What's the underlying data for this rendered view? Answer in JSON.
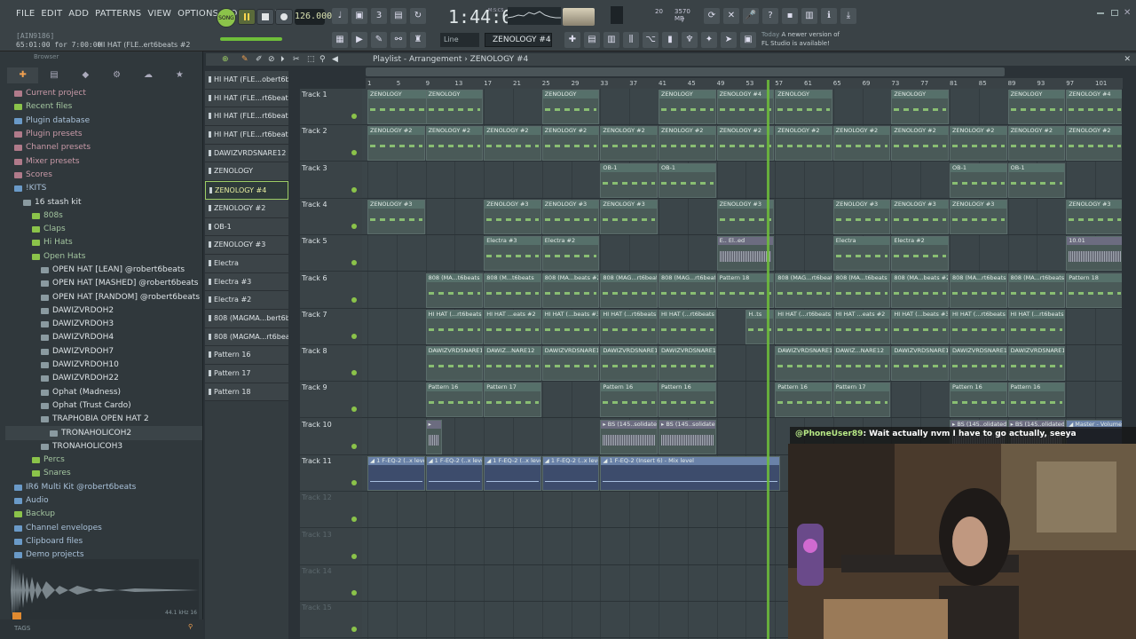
{
  "menus": [
    "FILE",
    "EDIT",
    "ADD",
    "PATTERNS",
    "VIEW",
    "OPTIONS",
    "TOOLS",
    "HELP"
  ],
  "hint": {
    "line1": "[AIN9186]",
    "time": "65:01:00 for 7:00:00",
    "channel": "HI HAT (FLE..ert6beats #2"
  },
  "transport": {
    "song_label": "SONG",
    "tempo": "126.000",
    "time": "1:44:63",
    "time_unit": "M:S:CS"
  },
  "cpu": {
    "memory": "3570 MB",
    "poly": "20",
    "voices": "7"
  },
  "toolbar": {
    "snap": "Line",
    "pattern": "ZENOLOGY #4"
  },
  "news": {
    "date": "Today",
    "text1": "A newer version of",
    "text2": "FL Studio is available!"
  },
  "browser": {
    "header": "Browser",
    "tabs": [
      "✚",
      "▤",
      "◆",
      "⚙",
      "☁",
      "★"
    ],
    "items": [
      {
        "label": "Current project",
        "color": "pink",
        "indent": 1
      },
      {
        "label": "Recent files",
        "color": "green",
        "indent": 1
      },
      {
        "label": "Plugin database",
        "color": "blue",
        "indent": 1
      },
      {
        "label": "Plugin presets",
        "color": "pink",
        "indent": 1
      },
      {
        "label": "Channel presets",
        "color": "pink",
        "indent": 1
      },
      {
        "label": "Mixer presets",
        "color": "pink",
        "indent": 1
      },
      {
        "label": "Scores",
        "color": "pink",
        "indent": 1
      },
      {
        "label": "!KITS",
        "color": "blue",
        "indent": 1
      },
      {
        "label": "16 stash kit",
        "color": "white",
        "indent": 2
      },
      {
        "label": "808s",
        "color": "green",
        "indent": 3
      },
      {
        "label": "Claps",
        "color": "green",
        "indent": 3
      },
      {
        "label": "Hi Hats",
        "color": "green",
        "indent": 3
      },
      {
        "label": "Open Hats",
        "color": "green",
        "indent": 3
      },
      {
        "label": "OPEN HAT [LEAN] @robert6beats",
        "color": "white",
        "indent": 4
      },
      {
        "label": "OPEN HAT [MASHED] @robert6beats",
        "color": "white",
        "indent": 4
      },
      {
        "label": "OPEN HAT [RANDOM] @robert6beats",
        "color": "white",
        "indent": 4
      },
      {
        "label": "DAWIZVRDOH2",
        "color": "white",
        "indent": 4
      },
      {
        "label": "DAWIZVRDOH3",
        "color": "white",
        "indent": 4
      },
      {
        "label": "DAWIZVRDOH4",
        "color": "white",
        "indent": 4
      },
      {
        "label": "DAWIZVRDOH7",
        "color": "white",
        "indent": 4
      },
      {
        "label": "DAWIZVRDOH10",
        "color": "white",
        "indent": 4
      },
      {
        "label": "DAWIZVRDOH22",
        "color": "white",
        "indent": 4
      },
      {
        "label": "Ophat (Madness)",
        "color": "white",
        "indent": 4
      },
      {
        "label": "Ophat (Trust Cardo)",
        "color": "white",
        "indent": 4
      },
      {
        "label": "TRAPHOBIA OPEN HAT 2",
        "color": "white",
        "indent": 4
      },
      {
        "label": "TRONAHOLICOH2",
        "color": "white",
        "indent": 5,
        "selected": true
      },
      {
        "label": "TRONAHOLICOH3",
        "color": "white",
        "indent": 4
      },
      {
        "label": "Percs",
        "color": "green",
        "indent": 3
      },
      {
        "label": "Snares",
        "color": "green",
        "indent": 3
      },
      {
        "label": "IR6 Multi Kit @robert6beats",
        "color": "blue",
        "indent": 1
      },
      {
        "label": "Audio",
        "color": "blue",
        "indent": 1
      },
      {
        "label": "Backup",
        "color": "green",
        "indent": 1
      },
      {
        "label": "Channel envelopes",
        "color": "blue",
        "indent": 1
      },
      {
        "label": "Clipboard files",
        "color": "blue",
        "indent": 1
      },
      {
        "label": "Demo projects",
        "color": "blue",
        "indent": 1
      }
    ],
    "tags": "TAGS",
    "sample_rate": "44.1 kHz 16"
  },
  "picker": [
    "HI HAT (FLE...obert6beats",
    "HI HAT (FLE...rt6beats #3",
    "HI HAT (FLE...rt6beats #2",
    "HI HAT (FLE...rt6beats #4",
    "DAWIZVRDSNARE12",
    "ZENOLOGY",
    "ZENOLOGY #4",
    "ZENOLOGY #2",
    "OB-1",
    "ZENOLOGY #3",
    "Electra",
    "Electra #3",
    "Electra #2",
    "808 (MAGMA...bert6beats",
    "808 (MAGMA...rt6beats #2",
    "Pattern 16",
    "Pattern 17",
    "Pattern 18"
  ],
  "picker_selected": 6,
  "playlist": {
    "title": "Playlist - Arrangement › ZENOLOGY #4",
    "ruler": [
      "1",
      "5",
      "9",
      "13",
      "17",
      "21",
      "25",
      "29",
      "33",
      "37",
      "41",
      "45",
      "49",
      "53",
      "57",
      "61",
      "65",
      "69",
      "73",
      "77",
      "81",
      "85",
      "89",
      "93",
      "97",
      "101"
    ],
    "tracks": [
      "Track 1",
      "Track 2",
      "Track 3",
      "Track 4",
      "Track 5",
      "Track 6",
      "Track 7",
      "Track 8",
      "Track 9",
      "Track 10",
      "Track 11",
      "Track 12",
      "Track 13",
      "Track 14",
      "Track 15"
    ],
    "clips": [
      {
        "t": 0,
        "s": 0,
        "e": 3,
        "l": "ZENOLOGY"
      },
      {
        "t": 0,
        "s": 2,
        "e": 4,
        "l": "ZENOLOGY"
      },
      {
        "t": 0,
        "s": 6,
        "e": 8,
        "l": "ZENOLOGY"
      },
      {
        "t": 0,
        "s": 10,
        "e": 12,
        "l": "ZENOLOGY"
      },
      {
        "t": 0,
        "s": 12,
        "e": 14,
        "l": "ZENOLOGY #4"
      },
      {
        "t": 0,
        "s": 14,
        "e": 16,
        "l": "ZENOLOGY"
      },
      {
        "t": 0,
        "s": 18,
        "e": 20,
        "l": "ZENOLOGY"
      },
      {
        "t": 0,
        "s": 22,
        "e": 24,
        "l": "ZENOLOGY"
      },
      {
        "t": 0,
        "s": 24,
        "e": 26,
        "l": "ZENOLOGY #4"
      },
      {
        "t": 1,
        "s": 0,
        "e": 2,
        "l": "ZENOLOGY #2"
      },
      {
        "t": 1,
        "s": 2,
        "e": 4,
        "l": "ZENOLOGY #2"
      },
      {
        "t": 1,
        "s": 4,
        "e": 6,
        "l": "ZENOLOGY #2"
      },
      {
        "t": 1,
        "s": 6,
        "e": 8,
        "l": "ZENOLOGY #2"
      },
      {
        "t": 1,
        "s": 8,
        "e": 10,
        "l": "ZENOLOGY #2"
      },
      {
        "t": 1,
        "s": 10,
        "e": 12,
        "l": "ZENOLOGY #2"
      },
      {
        "t": 1,
        "s": 12,
        "e": 14,
        "l": "ZENOLOGY #2"
      },
      {
        "t": 1,
        "s": 14,
        "e": 16,
        "l": "ZENOLOGY #2"
      },
      {
        "t": 1,
        "s": 16,
        "e": 18,
        "l": "ZENOLOGY #2"
      },
      {
        "t": 1,
        "s": 18,
        "e": 20,
        "l": "ZENOLOGY #2"
      },
      {
        "t": 1,
        "s": 20,
        "e": 22,
        "l": "ZENOLOGY #2"
      },
      {
        "t": 1,
        "s": 22,
        "e": 24,
        "l": "ZENOLOGY #2"
      },
      {
        "t": 1,
        "s": 24,
        "e": 26,
        "l": "ZENOLOGY #2"
      },
      {
        "t": 2,
        "s": 8,
        "e": 10,
        "l": "OB-1"
      },
      {
        "t": 2,
        "s": 10,
        "e": 12,
        "l": "OB-1"
      },
      {
        "t": 2,
        "s": 20,
        "e": 22,
        "l": "OB-1"
      },
      {
        "t": 2,
        "s": 22,
        "e": 24,
        "l": "OB-1"
      },
      {
        "t": 3,
        "s": 0,
        "e": 2,
        "l": "ZENOLOGY #3"
      },
      {
        "t": 3,
        "s": 4,
        "e": 6,
        "l": "ZENOLOGY #3"
      },
      {
        "t": 3,
        "s": 6,
        "e": 8,
        "l": "ZENOLOGY #3"
      },
      {
        "t": 3,
        "s": 8,
        "e": 10,
        "l": "ZENOLOGY #3"
      },
      {
        "t": 3,
        "s": 12,
        "e": 14,
        "l": "ZENOLOGY #3"
      },
      {
        "t": 3,
        "s": 16,
        "e": 18,
        "l": "ZENOLOGY #3"
      },
      {
        "t": 3,
        "s": 18,
        "e": 20,
        "l": "ZENOLOGY #3"
      },
      {
        "t": 3,
        "s": 20,
        "e": 22,
        "l": "ZENOLOGY #3"
      },
      {
        "t": 3,
        "s": 24,
        "e": 26,
        "l": "ZENOLOGY #3"
      },
      {
        "t": 4,
        "s": 4,
        "e": 6,
        "l": "Electra #3"
      },
      {
        "t": 4,
        "s": 6,
        "e": 8,
        "l": "Electra #2"
      },
      {
        "t": 4,
        "s": 12,
        "e": 14,
        "l": "E..  El..ed",
        "a": 1
      },
      {
        "t": 4,
        "s": 16,
        "e": 18,
        "l": "Electra"
      },
      {
        "t": 4,
        "s": 18,
        "e": 20,
        "l": "Electra #2"
      },
      {
        "t": 4,
        "s": 24,
        "e": 26,
        "l": "10.01",
        "a": 1
      },
      {
        "t": 5,
        "s": 2,
        "e": 4,
        "l": "808 (MA...t6beats"
      },
      {
        "t": 5,
        "s": 4,
        "e": 6,
        "l": "808 (M...t6beats"
      },
      {
        "t": 5,
        "s": 6,
        "e": 8,
        "l": "808 (MA...beats #2"
      },
      {
        "t": 5,
        "s": 8,
        "e": 10,
        "l": "808 (MAG...rt6beats"
      },
      {
        "t": 5,
        "s": 10,
        "e": 12,
        "l": "808 (MAG...rt6beats"
      },
      {
        "t": 5,
        "s": 12,
        "e": 14,
        "l": "Pattern 18"
      },
      {
        "t": 5,
        "s": 14,
        "e": 16,
        "l": "808 (MAG...rt6beats"
      },
      {
        "t": 5,
        "s": 16,
        "e": 18,
        "l": "808 (MA...t6beats"
      },
      {
        "t": 5,
        "s": 18,
        "e": 20,
        "l": "808 (MA...beats #2"
      },
      {
        "t": 5,
        "s": 20,
        "e": 22,
        "l": "808 (MA...rt6beats"
      },
      {
        "t": 5,
        "s": 22,
        "e": 24,
        "l": "808 (MA...rt6beats"
      },
      {
        "t": 5,
        "s": 24,
        "e": 26,
        "l": "Pattern 18"
      },
      {
        "t": 6,
        "s": 2,
        "e": 4,
        "l": "HI HAT (...rt6beats"
      },
      {
        "t": 6,
        "s": 4,
        "e": 6,
        "l": "HI HAT ...eats #2"
      },
      {
        "t": 6,
        "s": 6,
        "e": 8,
        "l": "HI HAT (...beats #3"
      },
      {
        "t": 6,
        "s": 8,
        "e": 10,
        "l": "HI HAT (...rt6beats"
      },
      {
        "t": 6,
        "s": 10,
        "e": 12,
        "l": "HI HAT (...rt6beats"
      },
      {
        "t": 6,
        "s": 13,
        "e": 14,
        "l": "H..ts"
      },
      {
        "t": 6,
        "s": 14,
        "e": 16,
        "l": "HI HAT (...rt6beats"
      },
      {
        "t": 6,
        "s": 16,
        "e": 18,
        "l": "HI HAT ...eats #2"
      },
      {
        "t": 6,
        "s": 18,
        "e": 20,
        "l": "HI HAT (...beats #3"
      },
      {
        "t": 6,
        "s": 20,
        "e": 22,
        "l": "HI HAT (...rt6beats"
      },
      {
        "t": 6,
        "s": 22,
        "e": 24,
        "l": "HI HAT (...rt6beats"
      },
      {
        "t": 7,
        "s": 2,
        "e": 4,
        "l": "DAWIZVRDSNARE12"
      },
      {
        "t": 7,
        "s": 4,
        "e": 6,
        "l": "DAWIZ...NARE12"
      },
      {
        "t": 7,
        "s": 6,
        "e": 8,
        "l": "DAWIZVRDSNARE12"
      },
      {
        "t": 7,
        "s": 8,
        "e": 10,
        "l": "DAWIZVRDSNARE12"
      },
      {
        "t": 7,
        "s": 10,
        "e": 12,
        "l": "DAWIZVRDSNARE12"
      },
      {
        "t": 7,
        "s": 14,
        "e": 16,
        "l": "DAWIZVRDSNARE12"
      },
      {
        "t": 7,
        "s": 16,
        "e": 18,
        "l": "DAWIZ...NARE12"
      },
      {
        "t": 7,
        "s": 18,
        "e": 20,
        "l": "DAWIZVRDSNARE12"
      },
      {
        "t": 7,
        "s": 20,
        "e": 22,
        "l": "DAWIZVRDSNARE12"
      },
      {
        "t": 7,
        "s": 22,
        "e": 24,
        "l": "DAWIZVRDSNARE12"
      },
      {
        "t": 8,
        "s": 2,
        "e": 4,
        "l": "Pattern 16"
      },
      {
        "t": 8,
        "s": 4,
        "e": 6,
        "l": "Pattern 17"
      },
      {
        "t": 8,
        "s": 8,
        "e": 10,
        "l": "Pattern 16"
      },
      {
        "t": 8,
        "s": 10,
        "e": 12,
        "l": "Pattern 16"
      },
      {
        "t": 8,
        "s": 14,
        "e": 16,
        "l": "Pattern 16"
      },
      {
        "t": 8,
        "s": 16,
        "e": 18,
        "l": "Pattern 17"
      },
      {
        "t": 8,
        "s": 20,
        "e": 22,
        "l": "Pattern 16"
      },
      {
        "t": 8,
        "s": 22,
        "e": 24,
        "l": "Pattern 16"
      },
      {
        "t": 9,
        "s": 2,
        "e": 2.6,
        "l": "▸",
        "a": 1
      },
      {
        "t": 9,
        "s": 8,
        "e": 10,
        "l": "▸ BS (145..solidated)",
        "a": 1
      },
      {
        "t": 9,
        "s": 10,
        "e": 12,
        "l": "▸ BS (145..solidated)",
        "a": 1
      },
      {
        "t": 9,
        "s": 20,
        "e": 22,
        "l": "▸ BS (145..olidated)",
        "a": 1
      },
      {
        "t": 9,
        "s": 22,
        "e": 24,
        "l": "▸ BS (145..olidated)",
        "a": 1
      },
      {
        "t": 9,
        "s": 24,
        "e": 26,
        "l": "◢ Master - Volume",
        "au": 1
      },
      {
        "t": 10,
        "s": 0,
        "e": 2,
        "l": "◢ 1 F-EQ-2 (..x level",
        "au": 1
      },
      {
        "t": 10,
        "s": 2,
        "e": 4,
        "l": "◢ 1 F-EQ-2 (..x level",
        "au": 1
      },
      {
        "t": 10,
        "s": 4,
        "e": 6,
        "l": "◢ 1 F-EQ-2 (..x level",
        "au": 1
      },
      {
        "t": 10,
        "s": 6,
        "e": 8,
        "l": "◢ 1 F-EQ-2 (..x level",
        "au": 1
      },
      {
        "t": 10,
        "s": 8,
        "e": 14.2,
        "l": "◢ 1 F-EQ-2 (Insert 6) - Mix level",
        "au": 1
      }
    ]
  },
  "chat": {
    "user": "@PhoneUser89",
    "message": ": Wait actually nvm I have to go actually, seeya"
  }
}
